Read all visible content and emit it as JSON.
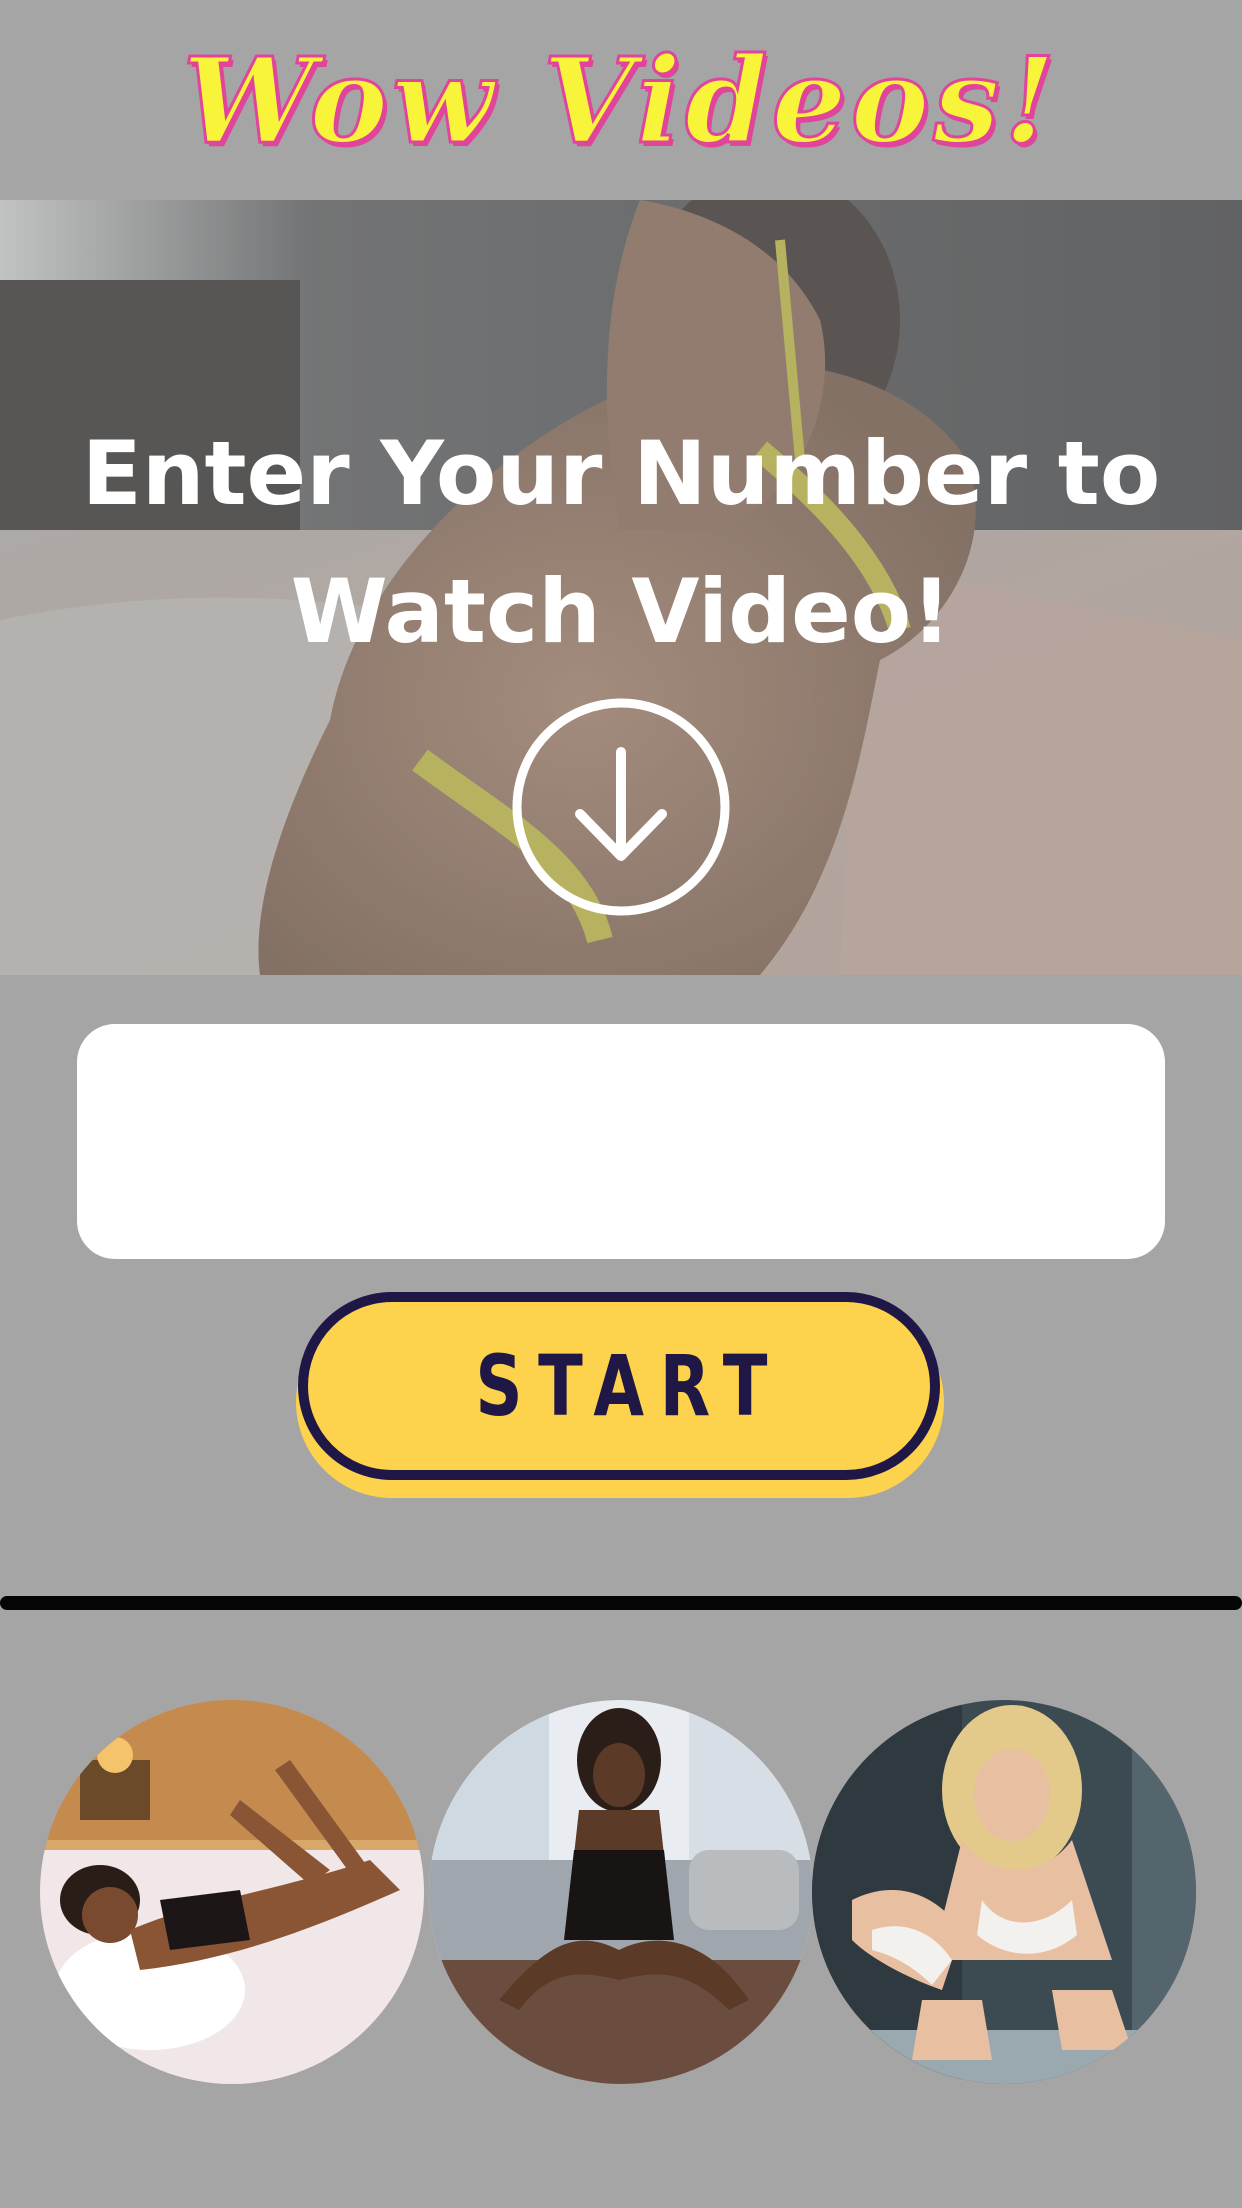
{
  "header": {
    "logo_text": "Wow Videos!"
  },
  "hero": {
    "headline": "Enter Your Number to Watch Video!",
    "icon": "arrow-down-circle-icon"
  },
  "form": {
    "phone_value": "",
    "phone_placeholder": "",
    "start_label": "START"
  },
  "thumbnails": [
    {
      "icon": "model-photo-1"
    },
    {
      "icon": "model-photo-2"
    },
    {
      "icon": "model-photo-3"
    }
  ],
  "colors": {
    "background": "#a5a5a5",
    "logo_fill": "#f8f43a",
    "logo_outline": "#e0459b",
    "button_fill": "#fdd24c",
    "button_border": "#1f1745",
    "divider": "#050505"
  }
}
